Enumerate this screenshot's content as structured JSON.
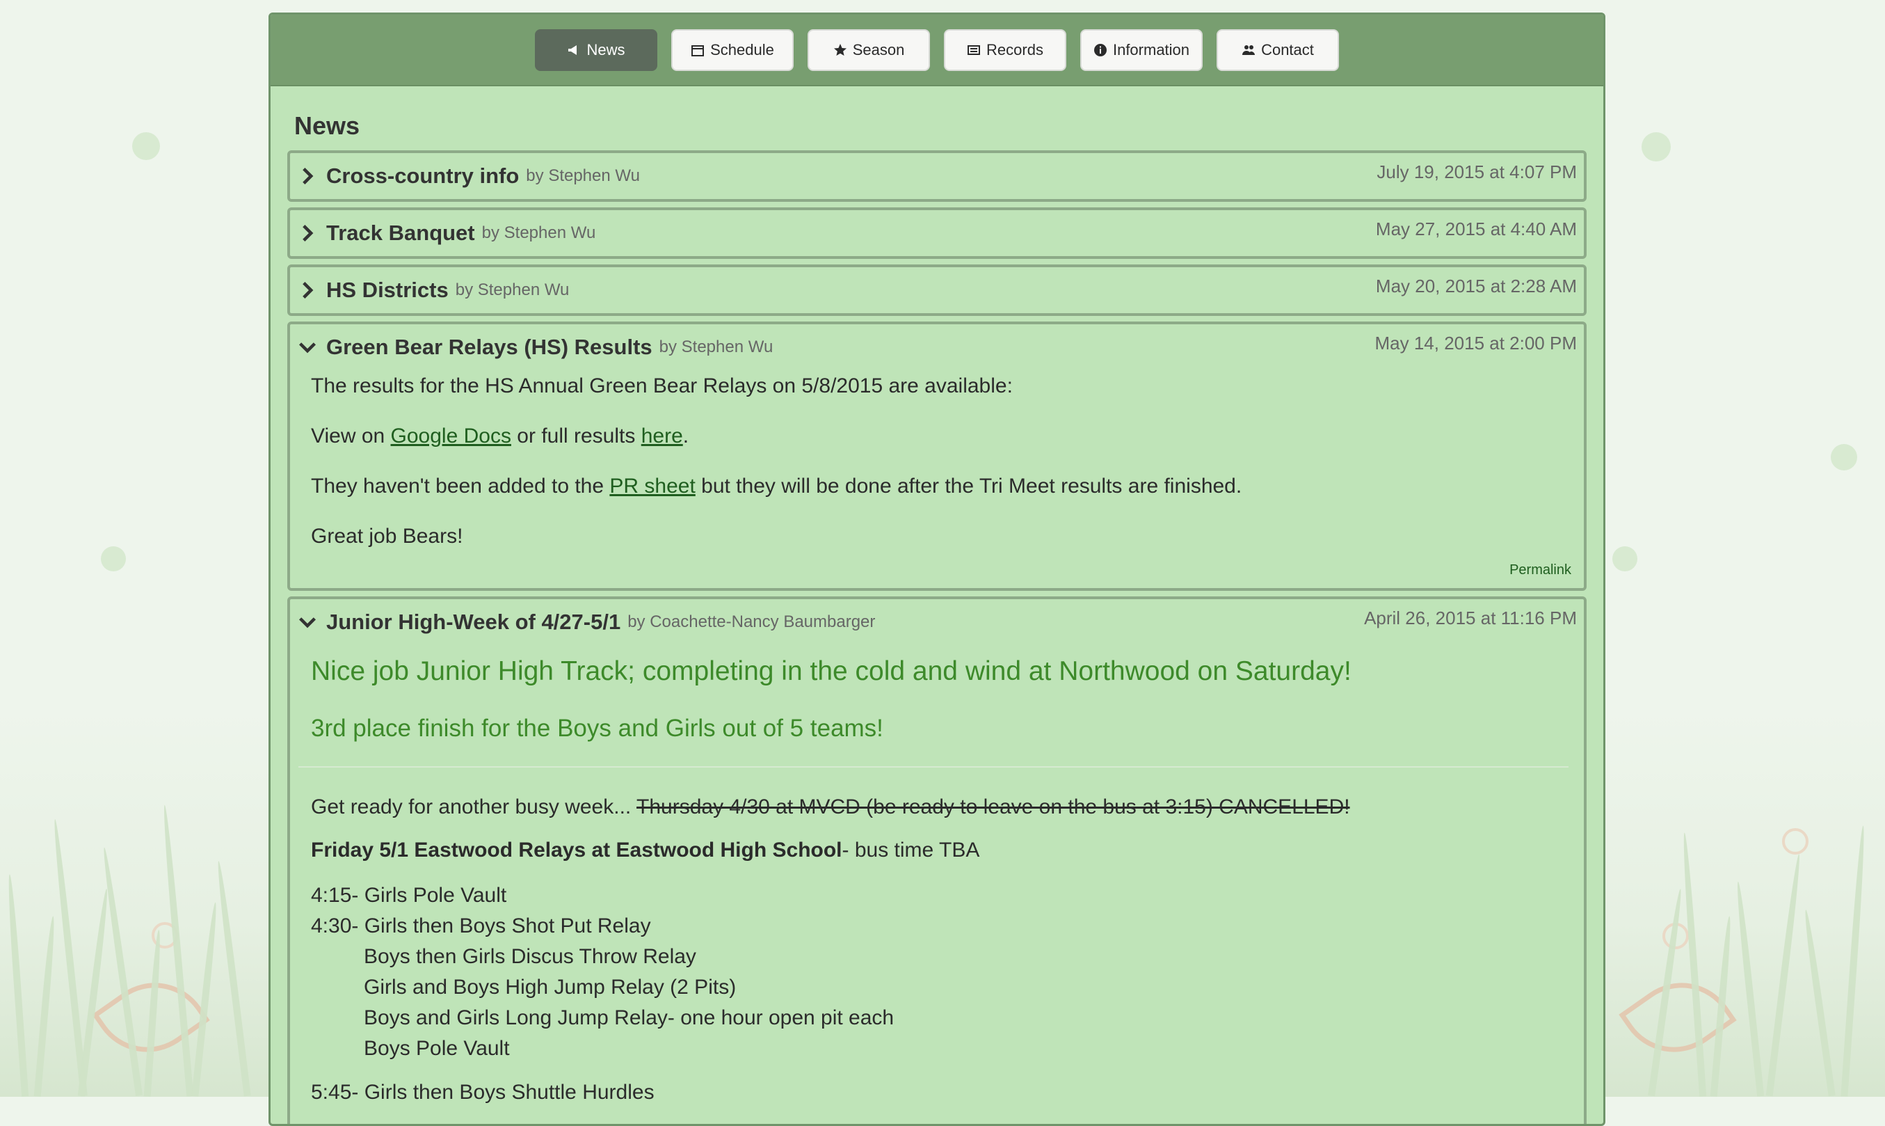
{
  "nav": [
    {
      "label": "News",
      "icon": "megaphone-icon",
      "active": true
    },
    {
      "label": "Schedule",
      "icon": "calendar-icon",
      "active": false
    },
    {
      "label": "Season",
      "icon": "star-icon",
      "active": false
    },
    {
      "label": "Records",
      "icon": "list-icon",
      "active": false
    },
    {
      "label": "Information",
      "icon": "info-icon",
      "active": false
    },
    {
      "label": "Contact",
      "icon": "users-icon",
      "active": false
    }
  ],
  "section_title": "News",
  "posts": [
    {
      "title": "Cross-country info",
      "by": "by Stephen Wu",
      "date": "July 19, 2015 at 4:07 PM",
      "expanded": false
    },
    {
      "title": "Track Banquet",
      "by": "by Stephen Wu",
      "date": "May 27, 2015 at 4:40 AM",
      "expanded": false
    },
    {
      "title": "HS Districts",
      "by": "by Stephen Wu",
      "date": "May 20, 2015 at 2:28 AM",
      "expanded": false
    },
    {
      "title": "Green Bear Relays (HS) Results",
      "by": "by Stephen Wu",
      "date": "May 14, 2015 at 2:00 PM",
      "expanded": true,
      "p1": "The results for the HS Annual Green Bear Relays on 5/8/2015 are available:",
      "p2_a": "View on ",
      "p2_link1": "Google Docs",
      "p2_b": " or full results ",
      "p2_link2": "here",
      "p2_c": ".",
      "p3_a": "They haven't been added to the ",
      "p3_link": "PR sheet",
      "p3_b": " but they will be done after the Tri Meet results are finished.",
      "p4": "Great job Bears!",
      "permalink": "Permalink"
    },
    {
      "title": "Junior High-Week of 4/27-5/1",
      "by": "by Coachette-Nancy Baumbarger",
      "date": "April 26, 2015 at 11:16 PM",
      "expanded": true,
      "headline": "Nice job Junior High Track; completing in the cold and wind at Northwood on Saturday!",
      "subhead": "3rd place finish for the Boys and Girls out of 5 teams!",
      "intro_a": "Get ready for another busy week... ",
      "intro_strike": "Thursday 4/30 at MVCD (be ready to leave on the bus at 3:15) CANCELLED!",
      "fri_bold": "Friday 5/1 Eastwood Relays at Eastwood High School",
      "fri_rest": "- bus time TBA",
      "schedule": [
        "4:15- Girls Pole Vault",
        "4:30- Girls then Boys Shot Put Relay",
        "Boys then Girls Discus Throw Relay",
        "Girls and Boys High Jump Relay (2 Pits)",
        "Boys and Girls Long Jump Relay- one hour open pit each",
        "Boys Pole Vault"
      ],
      "next_line": "5:45- Girls then Boys Shuttle Hurdles"
    }
  ]
}
